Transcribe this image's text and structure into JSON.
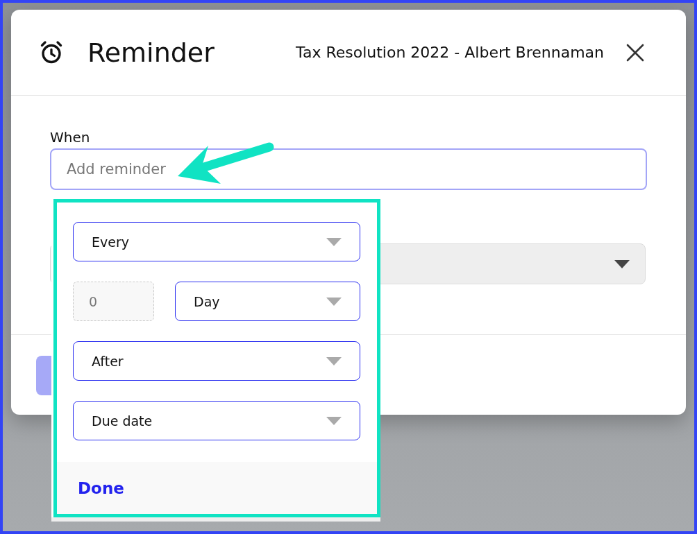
{
  "dialog": {
    "title": "Reminder",
    "subtitle": "Tax Resolution 2022 - Albert Brennaman",
    "when": {
      "label": "When",
      "placeholder": "Add reminder"
    }
  },
  "popover": {
    "rows": [
      {
        "kind": "select",
        "value": "Every"
      },
      {
        "kind": "pair",
        "number": {
          "value": "0",
          "disabled": true
        },
        "value": "Day"
      },
      {
        "kind": "select",
        "value": "After"
      },
      {
        "kind": "select",
        "value": "Due date"
      }
    ],
    "done": "Done"
  }
}
